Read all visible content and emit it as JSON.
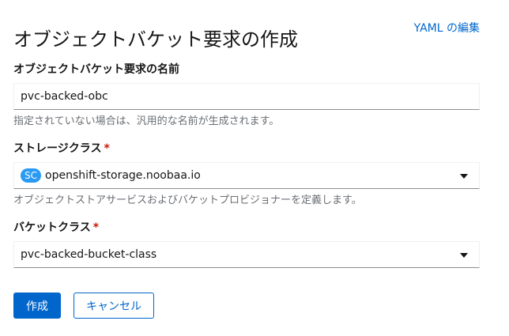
{
  "header": {
    "title": "オブジェクトバケット要求の作成",
    "yaml_link": "YAML の編集"
  },
  "form": {
    "name_field": {
      "label": "オブジェクトバケット要求の名前",
      "value": "pvc-backed-obc",
      "helper": "指定されていない場合は、汎用的な名前が生成されます。"
    },
    "storage_class": {
      "label": "ストレージクラス",
      "required_marker": "*",
      "badge": "SC",
      "value": "openshift-storage.noobaa.io",
      "helper": "オブジェクトストアサービスおよびバケットプロビジョナーを定義します。"
    },
    "bucket_class": {
      "label": "バケットクラス",
      "required_marker": "*",
      "value": "pvc-backed-bucket-class"
    }
  },
  "actions": {
    "create_label": "作成",
    "cancel_label": "キャンセル"
  },
  "colors": {
    "primary": "#0066cc",
    "badge": "#2b9af3",
    "required": "#c9190b",
    "helper_text": "#6a6e73"
  },
  "icons": {
    "dropdown": "caret-down-icon"
  }
}
